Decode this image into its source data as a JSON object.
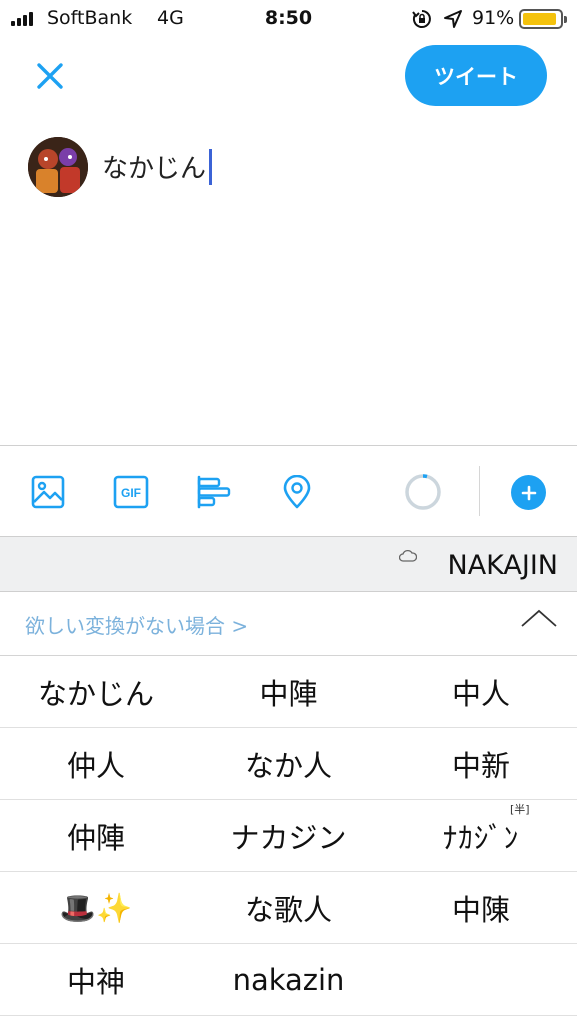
{
  "status_bar": {
    "carrier": "SoftBank",
    "network": "4G",
    "time": "8:50",
    "battery_percent": "91%",
    "battery_level": 0.91,
    "battery_color": "#f4c20d"
  },
  "compose": {
    "tweet_button_label": "ツイート",
    "text": "なかじん",
    "accent_color": "#1da1f2"
  },
  "toolbar": {
    "icons": [
      "image-icon",
      "gif-icon",
      "poll-icon",
      "location-icon",
      "character-counter",
      "add-tweet-icon"
    ],
    "gif_label": "GIF"
  },
  "keyboard": {
    "top_candidate": "NAKAJIN",
    "suggest_link": "欲しい変換がない場合 >",
    "candidates": [
      [
        "なかじん",
        "中陣",
        "中人"
      ],
      [
        "仲人",
        "なか人",
        "中新"
      ],
      [
        "仲陣",
        "ナカジン",
        "ﾅｶｼﾞﾝ"
      ],
      [
        "🎩✨",
        "な歌人",
        "中陳"
      ],
      [
        "中神",
        "nakazin",
        ""
      ]
    ],
    "half_width_badge": "[半]"
  }
}
